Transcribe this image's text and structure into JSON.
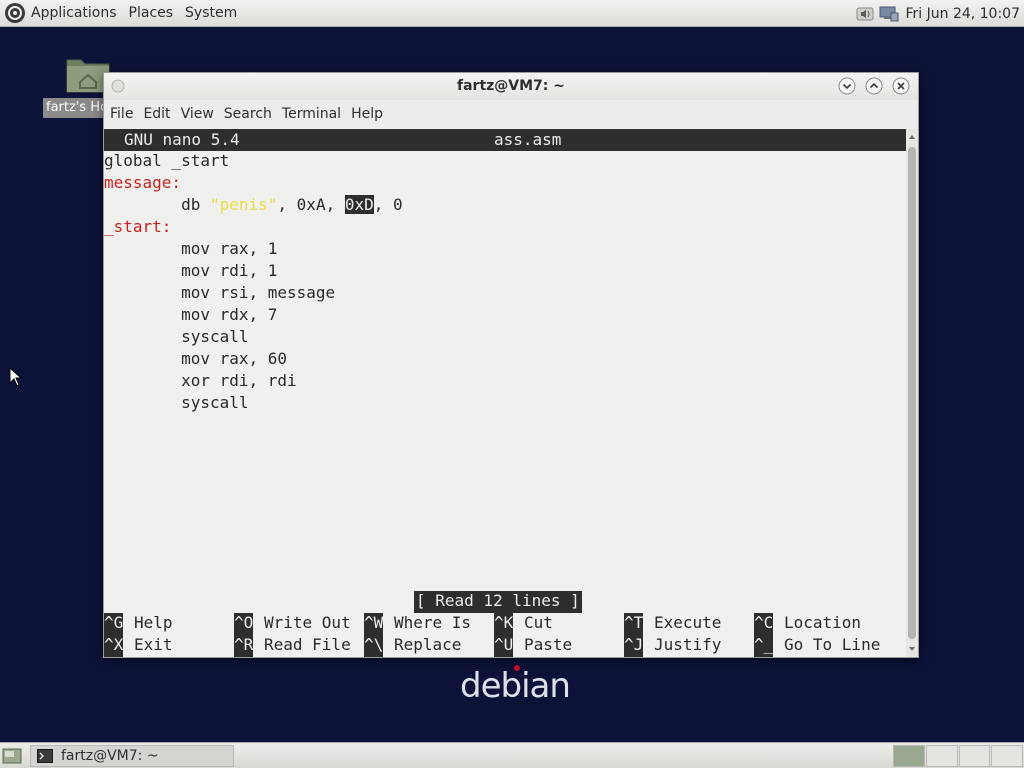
{
  "top_panel": {
    "menus": [
      "Applications",
      "Places",
      "System"
    ],
    "clock": "Fri Jun 24, 10:07"
  },
  "desktop": {
    "home_label": "fartz's Home"
  },
  "window": {
    "title": "fartz@VM7: ~",
    "menu": [
      "File",
      "Edit",
      "View",
      "Search",
      "Terminal",
      "Help"
    ]
  },
  "nano": {
    "version": "GNU nano 5.4",
    "filename": "ass.asm",
    "lines": {
      "l1": "global _start",
      "l2": "message:",
      "l3_pre": "        db ",
      "l3_str": "\"penis\"",
      "l3_mid": ", 0xA, ",
      "l3_hl": "0xD",
      "l3_post": ", 0",
      "l4": "_start:",
      "l5": "        mov rax, 1",
      "l6": "        mov rdi, 1",
      "l7": "        mov rsi, message",
      "l8": "        mov rdx, 7",
      "l9": "        syscall",
      "l10": "        mov rax, 60",
      "l11": "        xor rdi, rdi",
      "l12": "        syscall"
    },
    "status": "[ Read 12 lines ]",
    "shortcuts": [
      {
        "key": "^G",
        "label": "Help"
      },
      {
        "key": "^O",
        "label": "Write Out"
      },
      {
        "key": "^W",
        "label": "Where Is"
      },
      {
        "key": "^K",
        "label": "Cut"
      },
      {
        "key": "^T",
        "label": "Execute"
      },
      {
        "key": "^C",
        "label": "Location"
      },
      {
        "key": "^X",
        "label": "Exit"
      },
      {
        "key": "^R",
        "label": "Read File"
      },
      {
        "key": "^\\",
        "label": "Replace"
      },
      {
        "key": "^U",
        "label": "Paste"
      },
      {
        "key": "^J",
        "label": "Justify"
      },
      {
        "key": "^_",
        "label": "Go To Line"
      }
    ]
  },
  "taskbar": {
    "window_label": "fartz@VM7: ~"
  },
  "colors": {
    "desktop_bg": "#0d1238",
    "label_red": "#c4241f",
    "string_yellow": "#e8e046",
    "nano_bar": "#2e2e2e"
  },
  "icons": {
    "menu_logo": "debian-swirl-icon",
    "volume": "speaker-icon",
    "network": "network-icon",
    "home_folder": "home-folder-icon"
  }
}
